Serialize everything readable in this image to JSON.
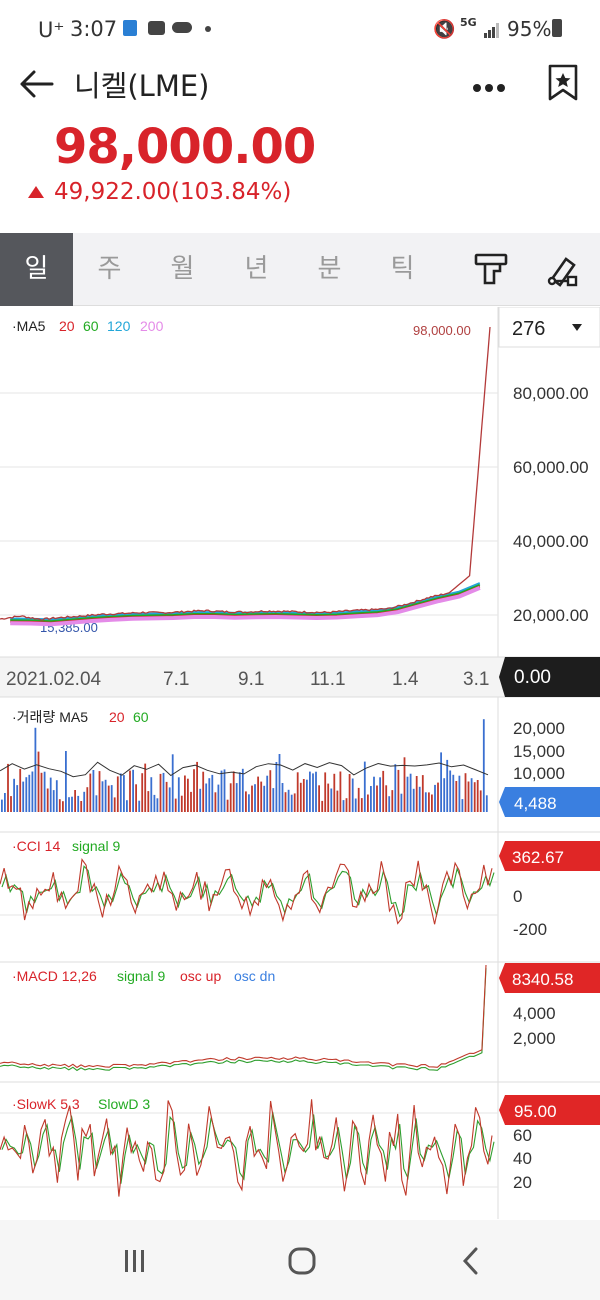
{
  "status_bar": {
    "carrier": "U⁺",
    "time": "3:07",
    "network": "5G",
    "battery": "95%"
  },
  "header": {
    "title": "니켈(LME)"
  },
  "price": {
    "current": "98,000.00",
    "change": "49,922.00(103.84%)",
    "up_color": "#d8232a"
  },
  "tabs": [
    "일",
    "주",
    "월",
    "년",
    "분",
    "틱"
  ],
  "main_chart": {
    "legend_prefix": "·MA5",
    "legend_ma": [
      {
        "label": "20",
        "color": "#d8232a"
      },
      {
        "label": "60",
        "color": "#22aa22"
      },
      {
        "label": "120",
        "color": "#22a6d8"
      },
      {
        "label": "200",
        "color": "#e48be8"
      }
    ],
    "period_count": "276",
    "high_label": "98,000.00",
    "low_label": "15,385.00",
    "y_ticks": [
      "80,000.00",
      "60,000.00",
      "40,000.00",
      "20,000.00"
    ],
    "x_ticks": [
      "2021.02.04",
      "7.1",
      "9.1",
      "11.1",
      "1.4",
      "3.1"
    ],
    "crosshair_value": "0.00"
  },
  "volume_chart": {
    "legend_prefix": "·거래량 MA5",
    "legend_ma": [
      {
        "label": "20",
        "color": "#d8232a"
      },
      {
        "label": "60",
        "color": "#22aa22"
      }
    ],
    "y_ticks": [
      "20,000",
      "15,000",
      "10,000"
    ],
    "current_value": "4,488"
  },
  "cci_chart": {
    "legend_main": "·CCI 14",
    "legend_signal": "signal 9",
    "y_ticks": [
      "0",
      "-200"
    ],
    "current_value": "362.67"
  },
  "macd_chart": {
    "legend_main": "·MACD 12,26",
    "legend_signal": "signal 9",
    "legend_osc_up": "osc up",
    "legend_osc_dn": "osc dn",
    "y_ticks": [
      "4,000",
      "2,000"
    ],
    "current_value": "8340.58"
  },
  "stoch_chart": {
    "legend_k": "·SlowK 5,3",
    "legend_d": "SlowD 3",
    "y_ticks": [
      "60",
      "40",
      "20"
    ],
    "current_value": "95.00"
  },
  "chart_data": [
    {
      "type": "line",
      "title": "니켈(LME) 일봉",
      "ylim": [
        15385,
        98000
      ],
      "x_ticks": [
        "2021.02.04",
        "7.1",
        "9.1",
        "11.1",
        "1.4",
        "3.1"
      ],
      "series": [
        {
          "name": "price",
          "values": [
            17600,
            18400,
            17500,
            18000,
            18400,
            18900,
            19100,
            19400,
            19300,
            19600,
            19900,
            19600,
            19500,
            19800,
            19700,
            19500,
            19400,
            19800,
            20100,
            20400,
            21800,
            23500,
            24800,
            29500,
            98000
          ]
        }
      ]
    },
    {
      "type": "bar",
      "title": "거래량",
      "ylim": [
        0,
        22000
      ],
      "current": 4488
    },
    {
      "type": "line",
      "title": "CCI 14",
      "current": 362.67
    },
    {
      "type": "line",
      "title": "MACD 12,26",
      "current": 8340.58
    },
    {
      "type": "line",
      "title": "SlowK 5,3",
      "current": 95.0
    }
  ]
}
